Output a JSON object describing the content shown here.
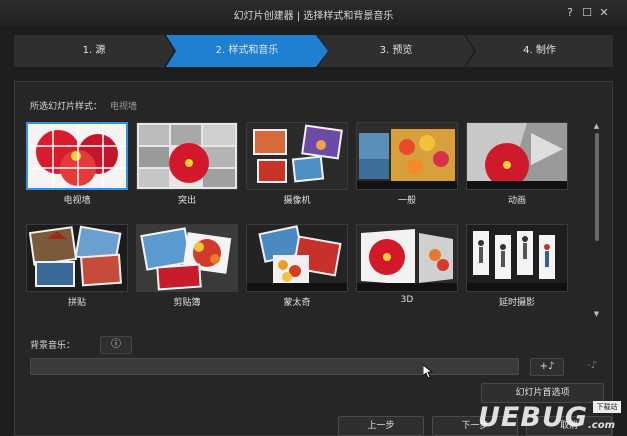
{
  "window": {
    "title": "幻灯片创建器 | 选择样式和背景音乐",
    "help": "?",
    "maximize": "☐",
    "close": "✕"
  },
  "steps": [
    {
      "label": "1. 源",
      "active": false
    },
    {
      "label": "2. 样式和音乐",
      "active": true
    },
    {
      "label": "3. 预览",
      "active": false
    },
    {
      "label": "4. 制作",
      "active": false
    }
  ],
  "style_select": {
    "label": "所选幻灯片样式：",
    "value": "电视墙"
  },
  "styles": [
    {
      "name": "电视墙",
      "selected": true,
      "icon": "tv-wall-thumbnail"
    },
    {
      "name": "突出",
      "selected": false,
      "icon": "highlight-thumbnail"
    },
    {
      "name": "摄像机",
      "selected": false,
      "icon": "camera-thumbnail"
    },
    {
      "name": "一般",
      "selected": false,
      "icon": "general-thumbnail"
    },
    {
      "name": "动画",
      "selected": false,
      "icon": "animation-thumbnail"
    },
    {
      "name": "拼贴",
      "selected": false,
      "icon": "collage-thumbnail"
    },
    {
      "name": "剪贴簿",
      "selected": false,
      "icon": "scrapbook-thumbnail"
    },
    {
      "name": "蒙太奇",
      "selected": false,
      "icon": "montage-thumbnail"
    },
    {
      "name": "3D",
      "selected": false,
      "icon": "3d-thumbnail"
    },
    {
      "name": "延时摄影",
      "selected": false,
      "icon": "timelapse-thumbnail"
    }
  ],
  "music": {
    "label": "背景音乐：",
    "info_glyph": "ⓘ",
    "field_value": "",
    "add_glyph": "+♪",
    "remove_glyph": "-♪"
  },
  "prefs_button": "幻灯片首选项",
  "buttons": {
    "back": "上一步",
    "next": "下一步",
    "cancel": "取消"
  },
  "watermark": {
    "text": "UEBUG",
    "suffix": ".com",
    "badge": "下载站"
  },
  "colors": {
    "accent": "#2e93e8",
    "step_active": "#1f7fd0",
    "step_inactive": "#2f2f2f"
  }
}
